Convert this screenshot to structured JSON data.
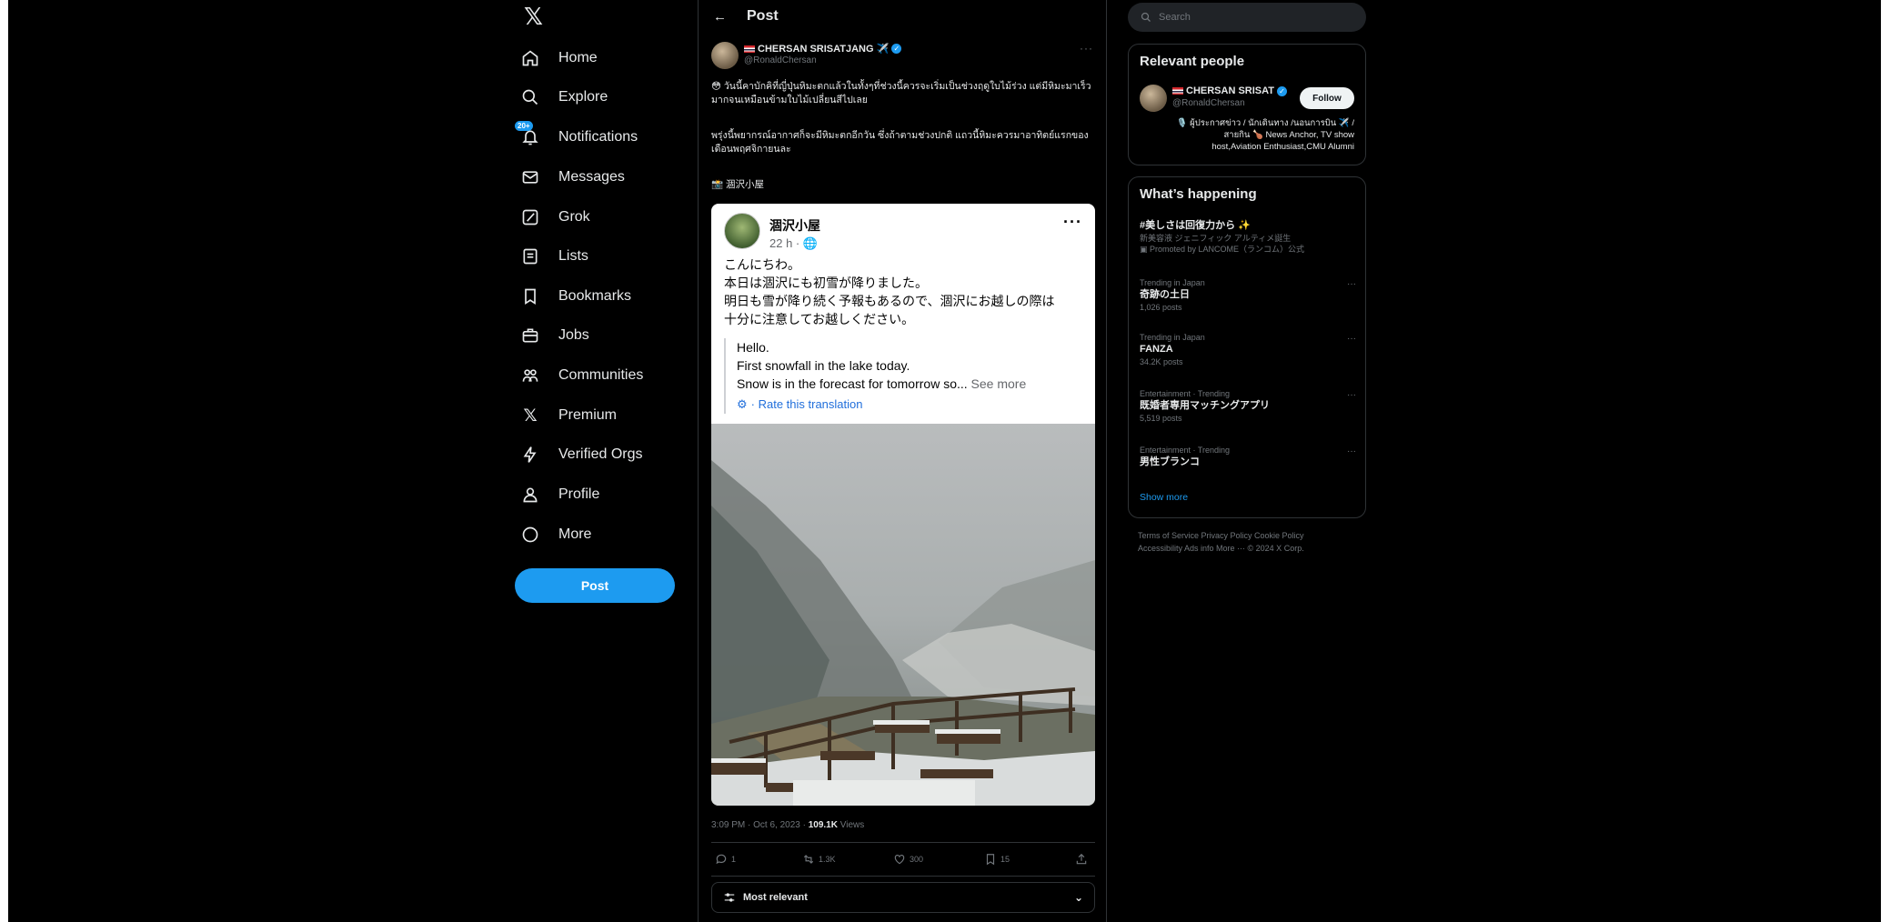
{
  "nav": {
    "items": [
      {
        "label": "Home",
        "icon": "home-icon"
      },
      {
        "label": "Explore",
        "icon": "search-icon"
      },
      {
        "label": "Notifications",
        "icon": "bell-icon",
        "badge": "20+"
      },
      {
        "label": "Messages",
        "icon": "envelope-icon"
      },
      {
        "label": "Grok",
        "icon": "grok-icon"
      },
      {
        "label": "Lists",
        "icon": "list-icon"
      },
      {
        "label": "Bookmarks",
        "icon": "bookmark-icon"
      },
      {
        "label": "Jobs",
        "icon": "briefcase-icon"
      },
      {
        "label": "Communities",
        "icon": "people-icon"
      },
      {
        "label": "Premium",
        "icon": "x-logo-icon"
      },
      {
        "label": "Verified Orgs",
        "icon": "lightning-icon"
      },
      {
        "label": "Profile",
        "icon": "person-icon"
      },
      {
        "label": "More",
        "icon": "more-circle-icon"
      }
    ],
    "post_button": "Post"
  },
  "header": {
    "title": "Post"
  },
  "post": {
    "author_name": "CHERSAN SRISATJANG ✈️",
    "author_handle": "@RonaldChersan",
    "text1": "😳 วันนี้คาบักคิที่ญี่ปุ่นหิมะตกแล้วในทั้งๆที่ช่วงนี้ควรจะเริ่มเป็นช่วงฤดูใบไม้ร่วง แต่มีหิมะมาเร็วมากจนเหมือนข้ามใบไม้เปลี่ยนสีไปเลย",
    "text2": "พรุ่งนี้พยากรณ์อากาศก็จะมีหิมะตกอีกวัน ซึ่งถ้าตามช่วงปกติ แถวนี้หิมะควรมาอาทิตย์แรกของเดือนพฤศจิกายนละ",
    "text3": "📸 涸沢小屋",
    "timestamp": "3:09 PM · Oct 6, 2023 · ",
    "views_count": "109.1K",
    "views_label": " Views",
    "replies": "1",
    "reposts": "1.3K",
    "likes": "300",
    "bookmarks": "15",
    "sort_label": "Most relevant"
  },
  "embed": {
    "name": "涸沢小屋",
    "time": "22 h · ",
    "jp_lines": [
      "こんにちわ。",
      "本日は涸沢にも初雪が降りました。",
      "明日も雪が降り続く予報もあるので、涸沢にお越しの際は",
      "十分に注意してお越しください。"
    ],
    "trans_lines": [
      "Hello.",
      "First snowfall in the lake today."
    ],
    "trans_last": "Snow is in the forecast for tomorrow so... ",
    "see_more": "See more",
    "rate": "· Rate this translation"
  },
  "search": {
    "placeholder": "Search"
  },
  "relevant": {
    "title": "Relevant people",
    "name": "CHERSAN SRISAT",
    "handle": "@RonaldChersan",
    "follow": "Follow",
    "bio": "🎙️ ผู้ประกาศข่าว / นักเดินทาง /นอนการบิน ✈️ /สายกิน 🍗 News Anchor, TV show host,Aviation Enthusiast,CMU Alumni"
  },
  "happening": {
    "title": "What’s happening",
    "trends": [
      {
        "meta": "",
        "name": "#美しさは回復力から ✨",
        "count": "新美容液 ジェニフィック アルティメ誕生",
        "promo": "Promoted by LANCOME（ランコム）公式"
      },
      {
        "meta": "Trending in Japan",
        "name": "奇跡の土日",
        "count": "1,026 posts"
      },
      {
        "meta": "Trending in Japan",
        "name": "FANZA",
        "count": "34.2K posts"
      },
      {
        "meta": "Entertainment · Trending",
        "name": "既婚者専用マッチングアプリ",
        "count": "5,519 posts"
      },
      {
        "meta": "Entertainment · Trending",
        "name": "男性ブランコ",
        "count": ""
      }
    ],
    "show_more": "Show more"
  },
  "footer": {
    "line1": "Terms of Service   Privacy Policy   Cookie Policy",
    "line2": "Accessibility   Ads info   More ···   © 2024 X Corp."
  }
}
